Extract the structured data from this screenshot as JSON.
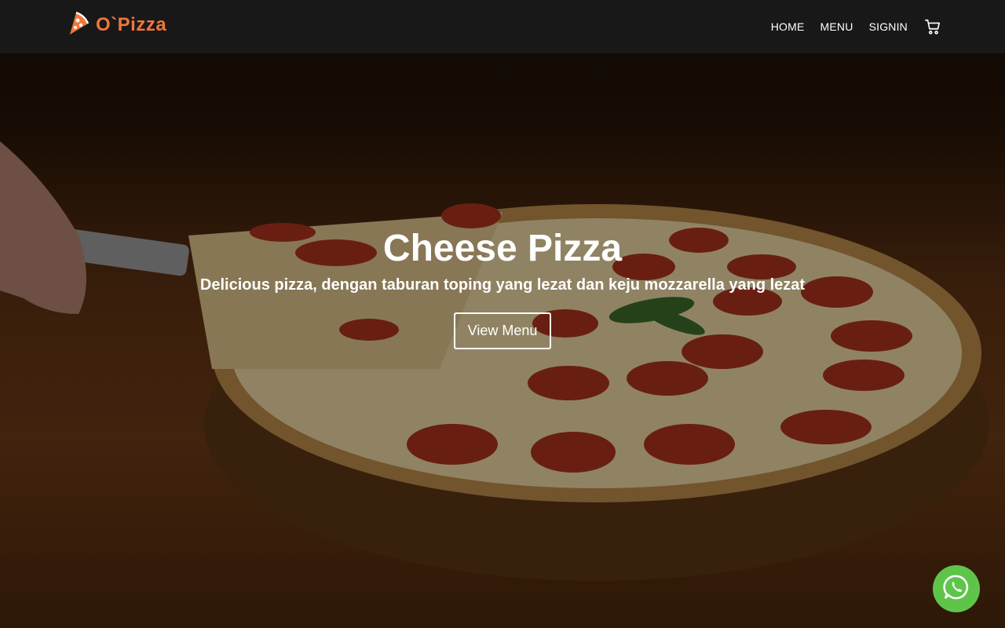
{
  "brand": {
    "name": "O`Pizza",
    "icon": "pizza-slice-icon",
    "color": "#f0763a"
  },
  "nav": {
    "items": [
      {
        "label": "HOME"
      },
      {
        "label": "MENU"
      },
      {
        "label": "SIGNIN"
      }
    ],
    "cart_icon": "cart-icon"
  },
  "hero": {
    "title": "Cheese Pizza",
    "subtitle": "Delicious pizza, dengan taburan toping yang lezat dan keju mozzarella yang lezat",
    "button_label": "View Menu"
  },
  "whatsapp": {
    "icon": "whatsapp-icon",
    "color": "#5fc54a"
  }
}
